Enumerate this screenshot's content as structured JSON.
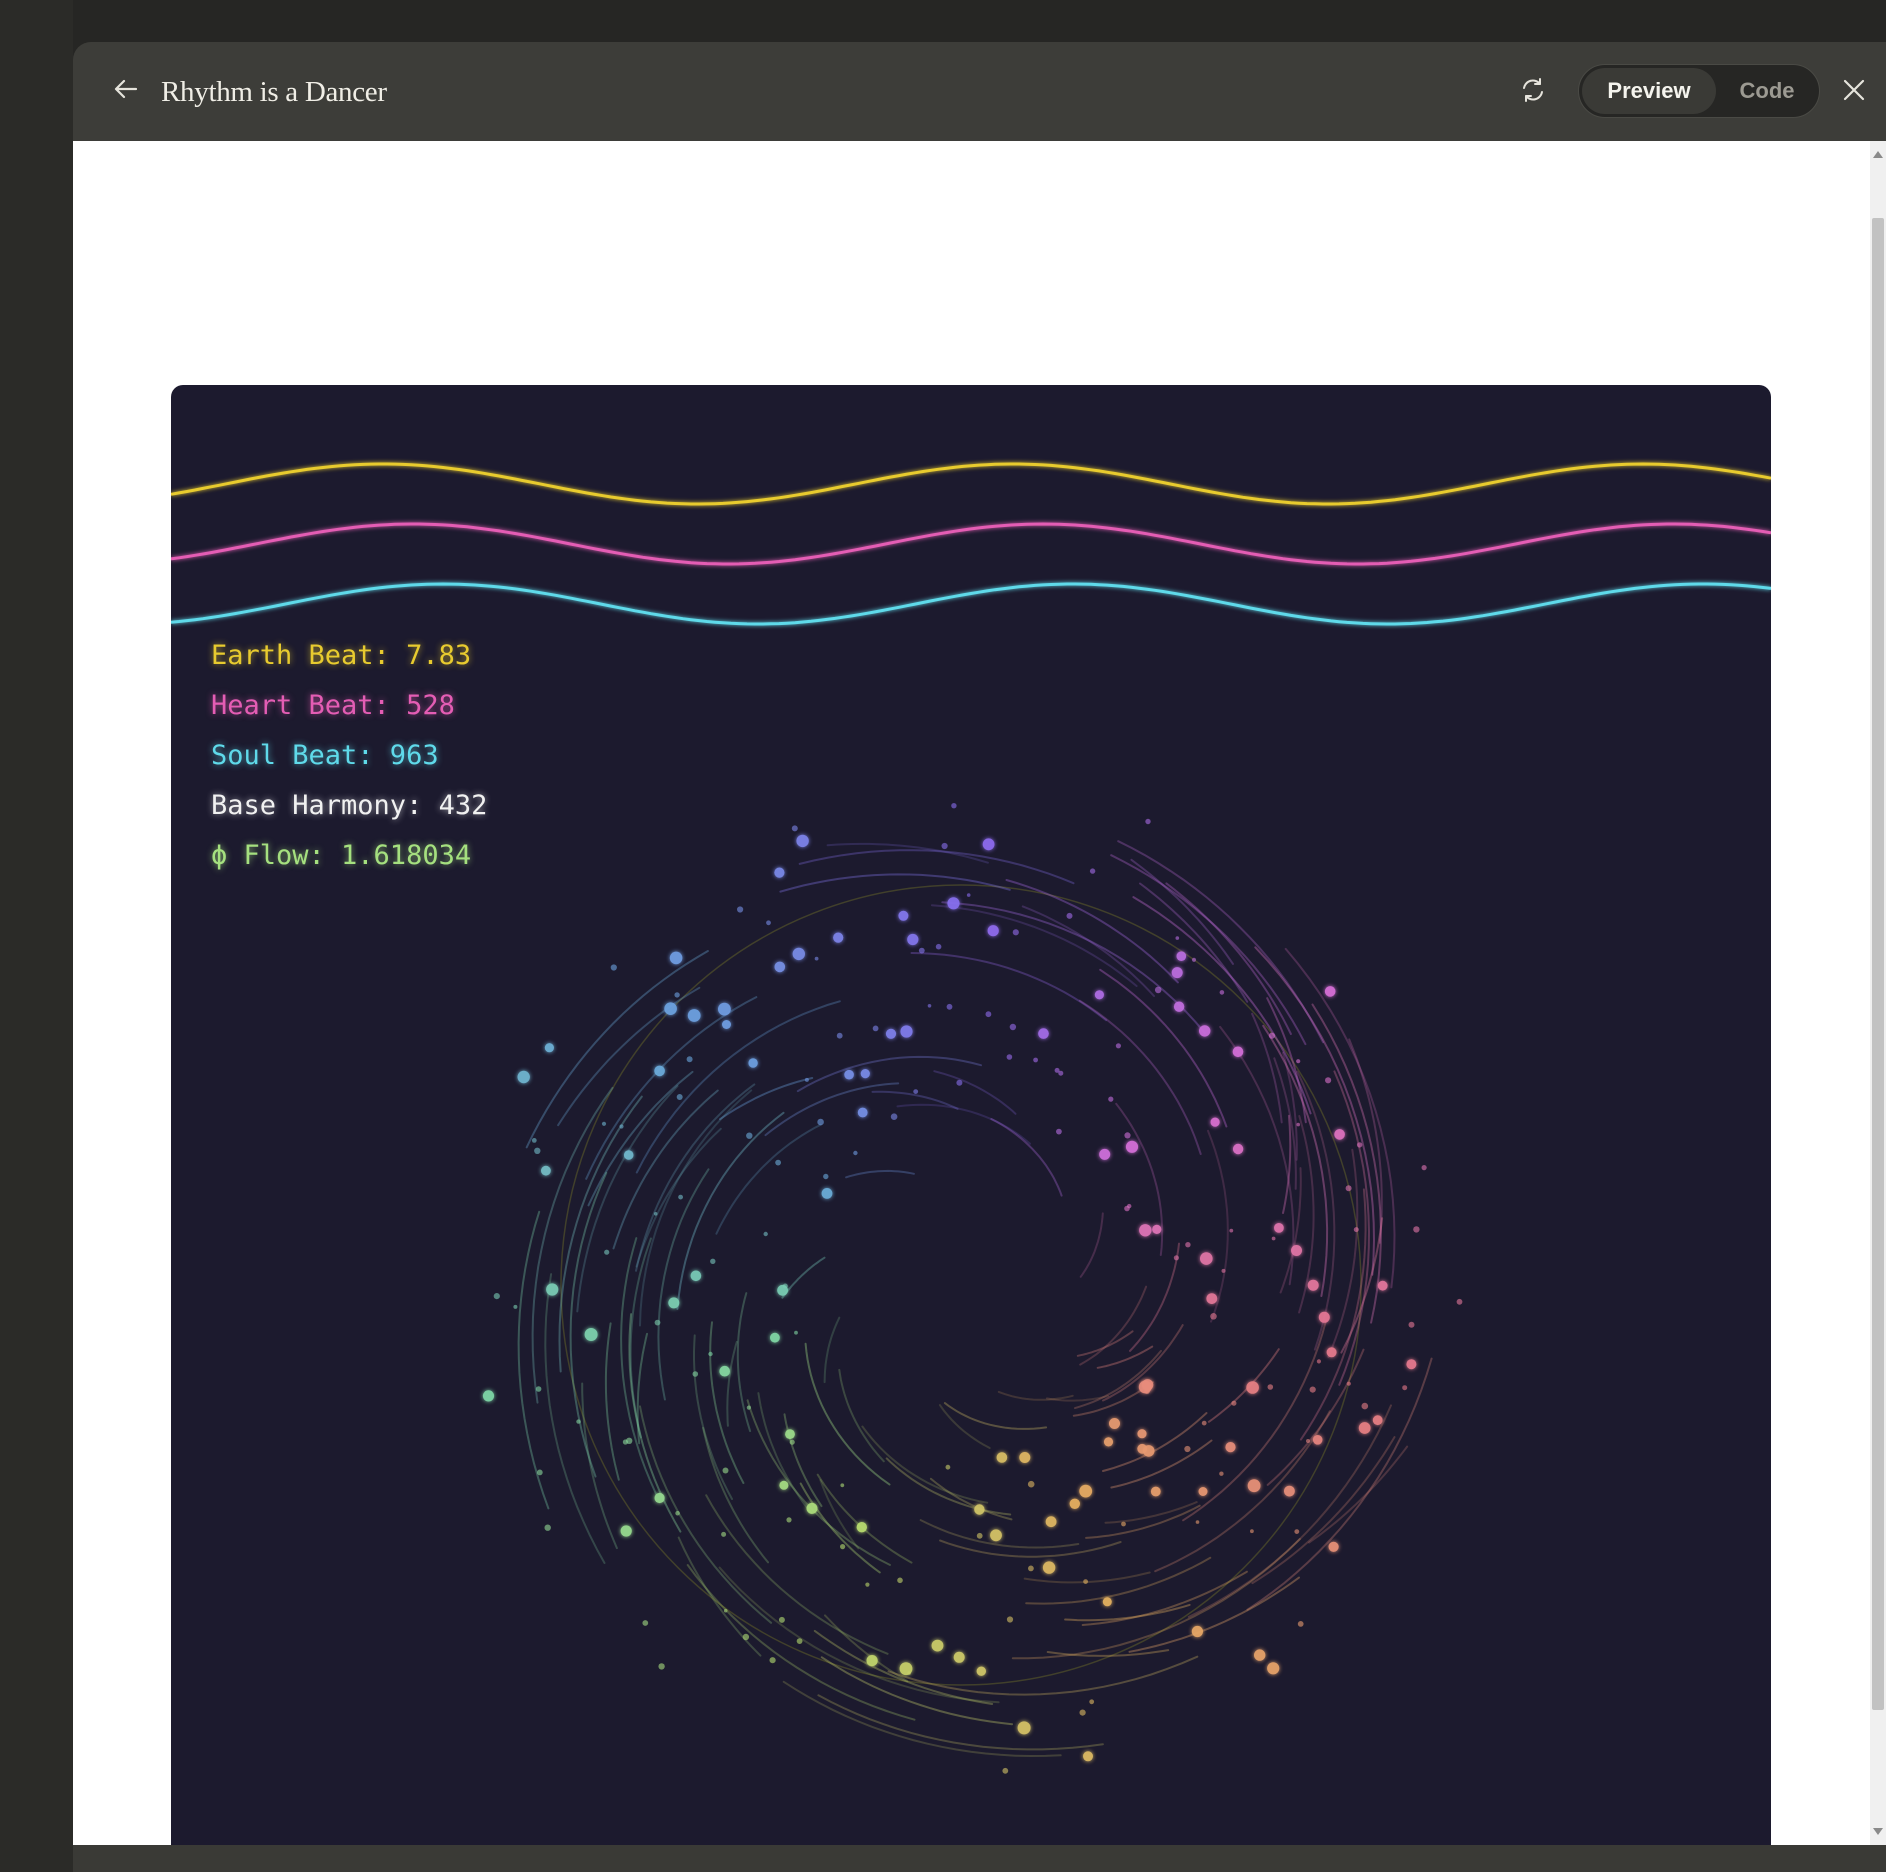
{
  "app": {
    "title": "Rhythm is a Dancer",
    "tabs": {
      "preview": "Preview",
      "code": "Code"
    },
    "active_tab": "preview",
    "icons": {
      "back": "arrow-left-icon",
      "refresh": "refresh-icon",
      "close": "close-icon"
    }
  },
  "hud": {
    "earth": "Earth Beat: 7.83",
    "heart": "Heart Beat: 528",
    "soul": "Soul Beat: 963",
    "base": "Base Harmony: 432",
    "phi": "ϕ Flow: 1.618034"
  },
  "colors": {
    "canvas_bg": "#1c1a2e",
    "earth_wave": "#e8cb2f",
    "heart_wave": "#e45db4",
    "soul_wave": "#5fdaea",
    "spiral_stops": [
      "#8a6cf0",
      "#d96fd8",
      "#e87a8a",
      "#e8b060",
      "#b8e070",
      "#7fd8a8",
      "#6aa8e0"
    ]
  }
}
